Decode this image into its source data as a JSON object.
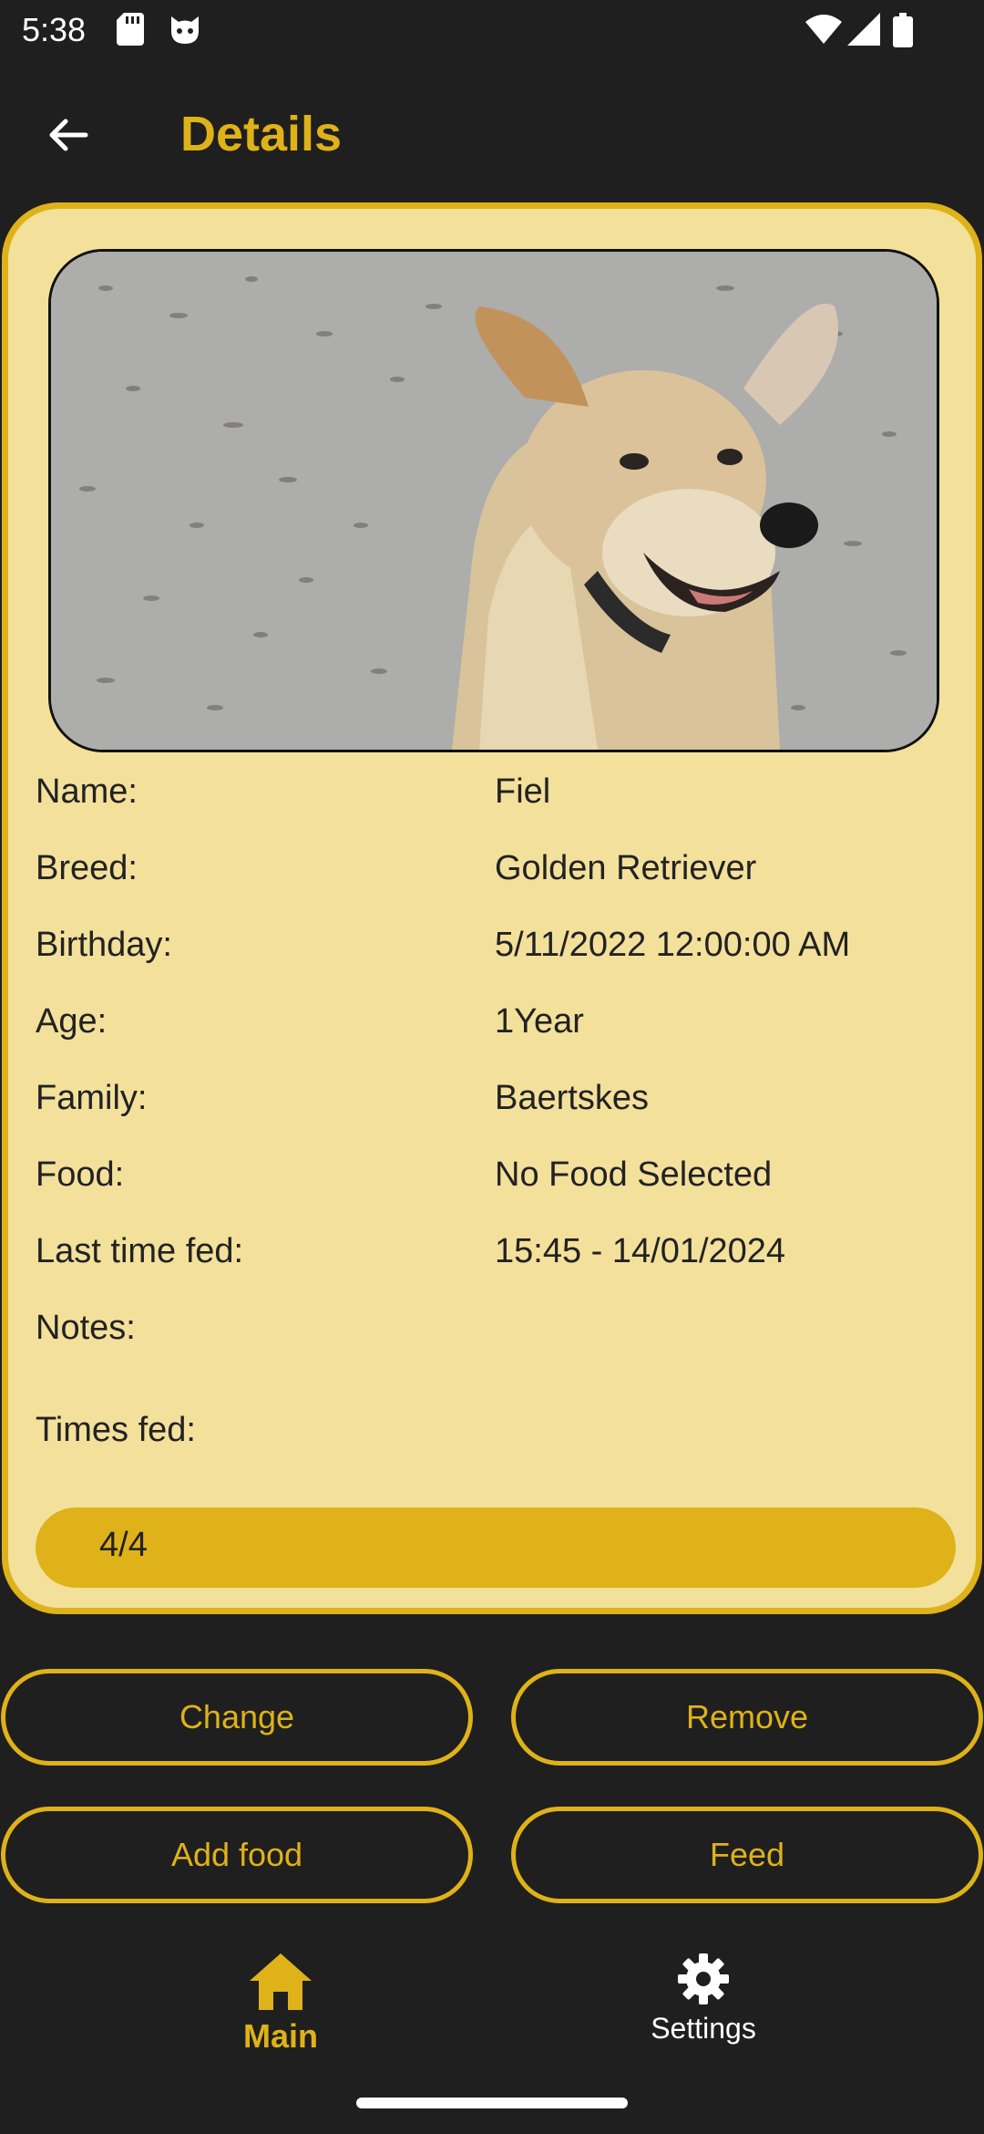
{
  "status_bar": {
    "time": "5:38",
    "icons": [
      "sd-card-icon",
      "cat-notification-icon",
      "wifi-icon",
      "signal-icon",
      "battery-icon"
    ]
  },
  "header": {
    "title": "Details",
    "back_icon": "arrow-back-icon"
  },
  "pet": {
    "photo": "golden-retriever-photo",
    "fields": [
      {
        "label": "Name:",
        "value": "Fiel"
      },
      {
        "label": "Breed:",
        "value": "Golden Retriever"
      },
      {
        "label": "Birthday:",
        "value": "5/11/2022 12:00:00 AM"
      },
      {
        "label": "Age:",
        "value": "1Year"
      },
      {
        "label": "Family:",
        "value": "Baertskes"
      },
      {
        "label": "Food:",
        "value": "No Food Selected"
      },
      {
        "label": "Last time fed:",
        "value": "15:45 - 14/01/2024"
      },
      {
        "label": "Notes:",
        "value": ""
      }
    ],
    "times_fed_label": "Times fed:",
    "times_fed_text": "4/4",
    "times_fed_fraction": 1.0
  },
  "actions": {
    "change": "Change",
    "remove": "Remove",
    "add_food": "Add food",
    "feed": "Feed"
  },
  "bottom_nav": {
    "items": [
      {
        "label": "Main",
        "icon": "home-icon",
        "active": true
      },
      {
        "label": "Settings",
        "icon": "gear-icon",
        "active": false
      }
    ]
  },
  "colors": {
    "accent": "#deb218",
    "card_background": "#f3e09b",
    "background": "#1f1f1f"
  }
}
